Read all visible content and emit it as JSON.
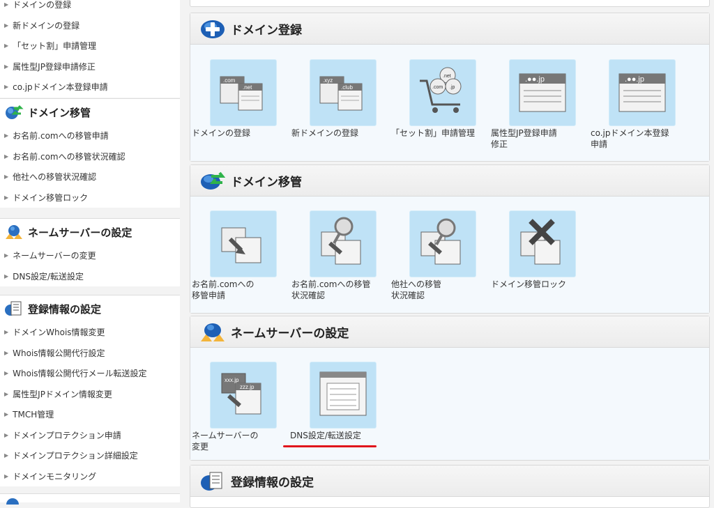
{
  "sidebar": {
    "top_items": [
      "ドメインの登録",
      "新ドメインの登録",
      "「セット割」申請管理",
      "属性型JP登録申請修正",
      "co.jpドメイン本登録申請"
    ],
    "sections": [
      {
        "title": "ドメイン移管",
        "icon": "globe-arrows-icon",
        "items": [
          "お名前.comへの移管申請",
          "お名前.comへの移管状況確認",
          "他社への移管状況確認",
          "ドメイン移管ロック"
        ]
      },
      {
        "title": "ネームサーバーの設定",
        "icon": "server-person-icon",
        "items": [
          "ネームサーバーの変更",
          "DNS設定/転送設定"
        ]
      },
      {
        "title": "登録情報の設定",
        "icon": "document-globe-icon",
        "items": [
          "ドメインWhois情報変更",
          "Whois情報公開代行設定",
          "Whois情報公開代行メール転送設定",
          "属性型JPドメイン情報変更",
          "TMCH管理",
          "ドメインプロテクション申請",
          "ドメインプロテクション詳細設定",
          "ドメインモニタリング"
        ]
      }
    ]
  },
  "main": {
    "panels": [
      {
        "title": "ドメイン登録",
        "icon": "plus-globe-icon",
        "tiles": [
          {
            "lines": [
              "ドメインの登録"
            ],
            "icon": "domain-com-net-icon",
            "labels": [
              ".com",
              ".net"
            ]
          },
          {
            "lines": [
              "新ドメインの登録"
            ],
            "icon": "domain-xyz-club-icon",
            "labels": [
              ".xyz",
              ".club"
            ]
          },
          {
            "lines": [
              "「セット割」申請管理"
            ],
            "icon": "shopping-cart-icon",
            "labels": [
              ".net",
              ".com",
              ".jp"
            ]
          },
          {
            "lines": [
              "属性型JP登録申請",
              "修正"
            ],
            "icon": "jp-document-icon",
            "labels": [
              ".●●.jp"
            ]
          },
          {
            "lines": [
              "co.jpドメイン本登録",
              "申請"
            ],
            "icon": "cojp-document-icon",
            "labels": [
              ".●●.jp"
            ]
          }
        ]
      },
      {
        "title": "ドメイン移管",
        "icon": "globe-arrows-icon",
        "tiles": [
          {
            "lines": [
              "お名前.comへの",
              "移管申請"
            ],
            "icon": "transfer-request-icon"
          },
          {
            "lines": [
              "お名前.comへの移管",
              "状況確認"
            ],
            "icon": "transfer-status-icon"
          },
          {
            "lines": [
              "他社への移管",
              "状況確認"
            ],
            "icon": "outbound-transfer-icon"
          },
          {
            "lines": [
              "ドメイン移管ロック"
            ],
            "icon": "transfer-lock-icon"
          }
        ]
      },
      {
        "title": "ネームサーバーの設定",
        "icon": "server-person-icon",
        "tiles": [
          {
            "lines": [
              "ネームサーバーの",
              "変更"
            ],
            "icon": "nameserver-change-icon",
            "labels": [
              "xxx.jp",
              "zzz.jp"
            ]
          },
          {
            "lines": [
              "DNS設定/転送設定"
            ],
            "icon": "dns-settings-icon",
            "highlighted": true
          }
        ]
      },
      {
        "title": "登録情報の設定",
        "icon": "document-globe-icon",
        "tiles": []
      }
    ]
  },
  "colors": {
    "tile_bg": "#bfe2f6",
    "highlight": "#e0151b",
    "panel_body": "#f4f9fd"
  }
}
